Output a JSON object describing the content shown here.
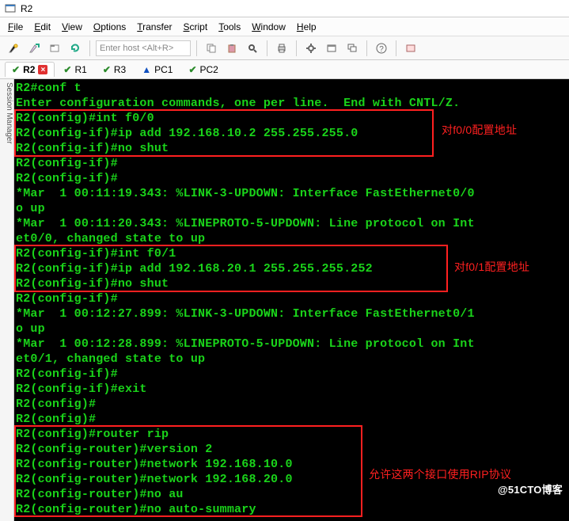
{
  "window": {
    "title": "R2"
  },
  "menu": {
    "file": "File",
    "edit": "Edit",
    "view": "View",
    "options": "Options",
    "transfer": "Transfer",
    "script": "Script",
    "tools": "Tools",
    "window": "Window",
    "help": "Help"
  },
  "toolbar": {
    "host_placeholder": "Enter host <Alt+R>"
  },
  "sidebar": {
    "label": "Session Manager"
  },
  "tabs": {
    "r2": "R2",
    "r1": "R1",
    "r3": "R3",
    "pc1": "PC1",
    "pc2": "PC2"
  },
  "terminal": {
    "lines": [
      "R2#conf t",
      "Enter configuration commands, one per line.  End with CNTL/Z.",
      "R2(config)#int f0/0",
      "R2(config-if)#ip add 192.168.10.2 255.255.255.0",
      "R2(config-if)#no shut",
      "R2(config-if)#",
      "R2(config-if)#",
      "*Mar  1 00:11:19.343: %LINK-3-UPDOWN: Interface FastEthernet0/0",
      "o up",
      "*Mar  1 00:11:20.343: %LINEPROTO-5-UPDOWN: Line protocol on Int",
      "et0/0, changed state to up",
      "R2(config-if)#int f0/1",
      "R2(config-if)#ip add 192.168.20.1 255.255.255.252",
      "R2(config-if)#no shut",
      "R2(config-if)#",
      "*Mar  1 00:12:27.899: %LINK-3-UPDOWN: Interface FastEthernet0/1",
      "o up",
      "*Mar  1 00:12:28.899: %LINEPROTO-5-UPDOWN: Line protocol on Int",
      "et0/1, changed state to up",
      "R2(config-if)#",
      "R2(config-if)#exit",
      "R2(config)#",
      "R2(config)#",
      "R2(config)#router rip",
      "R2(config-router)#version 2",
      "R2(config-router)#network 192.168.10.0",
      "R2(config-router)#network 192.168.20.0",
      "R2(config-router)#no au",
      "R2(config-router)#no auto-summary"
    ]
  },
  "annotations": {
    "a1": "对f0/0配置地址",
    "a2": "对f0/1配置地址",
    "a3": "允许这两个接口使用RIP协议"
  },
  "watermark": "@51CTO博客"
}
